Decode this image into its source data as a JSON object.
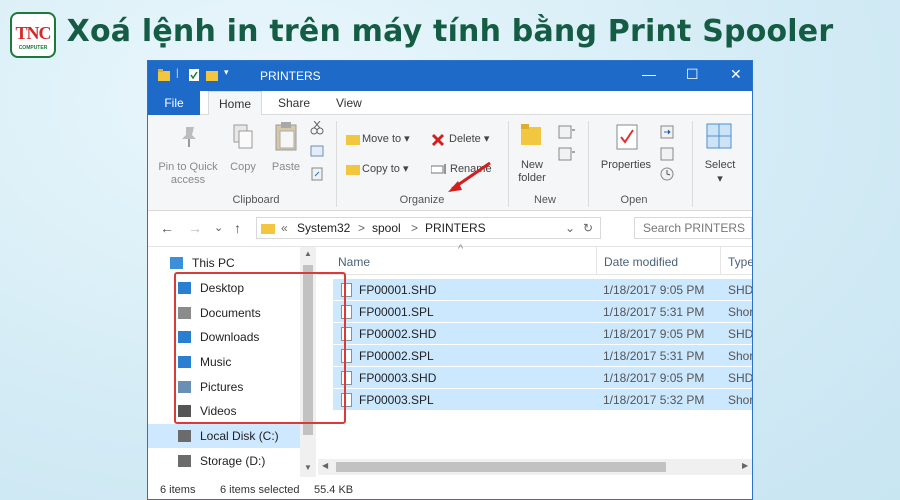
{
  "headline": "Xoá lệnh in trên máy tính bằng Print Spooler",
  "logo": {
    "text": "TNC",
    "sub": "COMPUTER"
  },
  "window": {
    "title": "PRINTERS",
    "controls": {
      "minimize": "—",
      "maximize": "☐",
      "close": "✕"
    }
  },
  "tabs": [
    "File",
    "Home",
    "Share",
    "View"
  ],
  "ribbon": {
    "clipboard": {
      "pin_label": "Pin to Quick access",
      "copy_label": "Copy",
      "paste_label": "Paste",
      "group": "Clipboard"
    },
    "organize": {
      "move_to": "Move to ▾",
      "copy_to": "Copy to ▾",
      "delete": "Delete ▾",
      "rename": "Rename",
      "group": "Organize"
    },
    "new": {
      "new_folder": "New folder",
      "group": "New"
    },
    "open": {
      "properties": "Properties",
      "group": "Open"
    },
    "select": {
      "select": "Select",
      "dropdown": "▾"
    }
  },
  "address": {
    "back": "←",
    "forward": "→",
    "recent": "⌄",
    "up": "↑",
    "path": [
      "«",
      "System32",
      ">",
      "spool",
      ">",
      "PRINTERS"
    ],
    "dropdown": "⌄",
    "refresh": "↻",
    "search_placeholder": "Search PRINTERS"
  },
  "nav_pane": {
    "items": [
      {
        "label": "This PC",
        "icon": "pc-icon",
        "color": "#3c8fd8"
      },
      {
        "label": "Desktop",
        "icon": "desktop-icon",
        "color": "#2a7fd0"
      },
      {
        "label": "Documents",
        "icon": "documents-icon",
        "color": "#8b8b8b"
      },
      {
        "label": "Downloads",
        "icon": "downloads-icon",
        "color": "#2a7fd0"
      },
      {
        "label": "Music",
        "icon": "music-icon",
        "color": "#2a7fd0"
      },
      {
        "label": "Pictures",
        "icon": "pictures-icon",
        "color": "#6a8fb5"
      },
      {
        "label": "Videos",
        "icon": "videos-icon",
        "color": "#555"
      },
      {
        "label": "Local Disk (C:)",
        "icon": "disk-icon",
        "color": "#6b6b6b"
      },
      {
        "label": "Storage (D:)",
        "icon": "disk-icon",
        "color": "#6b6b6b"
      }
    ],
    "selected_index": 7
  },
  "file_list": {
    "columns": {
      "name": "Name",
      "date": "Date modified",
      "type": "Type"
    },
    "sort_glyph": "^",
    "rows": [
      {
        "name": "FP00001.SHD",
        "date": "1/18/2017 9:05 PM",
        "type": "SHD"
      },
      {
        "name": "FP00001.SPL",
        "date": "1/18/2017 5:31 PM",
        "type": "Shor"
      },
      {
        "name": "FP00002.SHD",
        "date": "1/18/2017 9:05 PM",
        "type": "SHD"
      },
      {
        "name": "FP00002.SPL",
        "date": "1/18/2017 5:31 PM",
        "type": "Shor"
      },
      {
        "name": "FP00003.SHD",
        "date": "1/18/2017 9:05 PM",
        "type": "SHD"
      },
      {
        "name": "FP00003.SPL",
        "date": "1/18/2017 5:32 PM",
        "type": "Shor"
      }
    ]
  },
  "status": {
    "items": "6 items",
    "selected": "6 items selected",
    "size": "55.4 KB"
  },
  "colors": {
    "accent": "#1d6ac9",
    "selection": "#cce8ff",
    "highlight": "#d93b3b",
    "headline": "#155c44"
  }
}
